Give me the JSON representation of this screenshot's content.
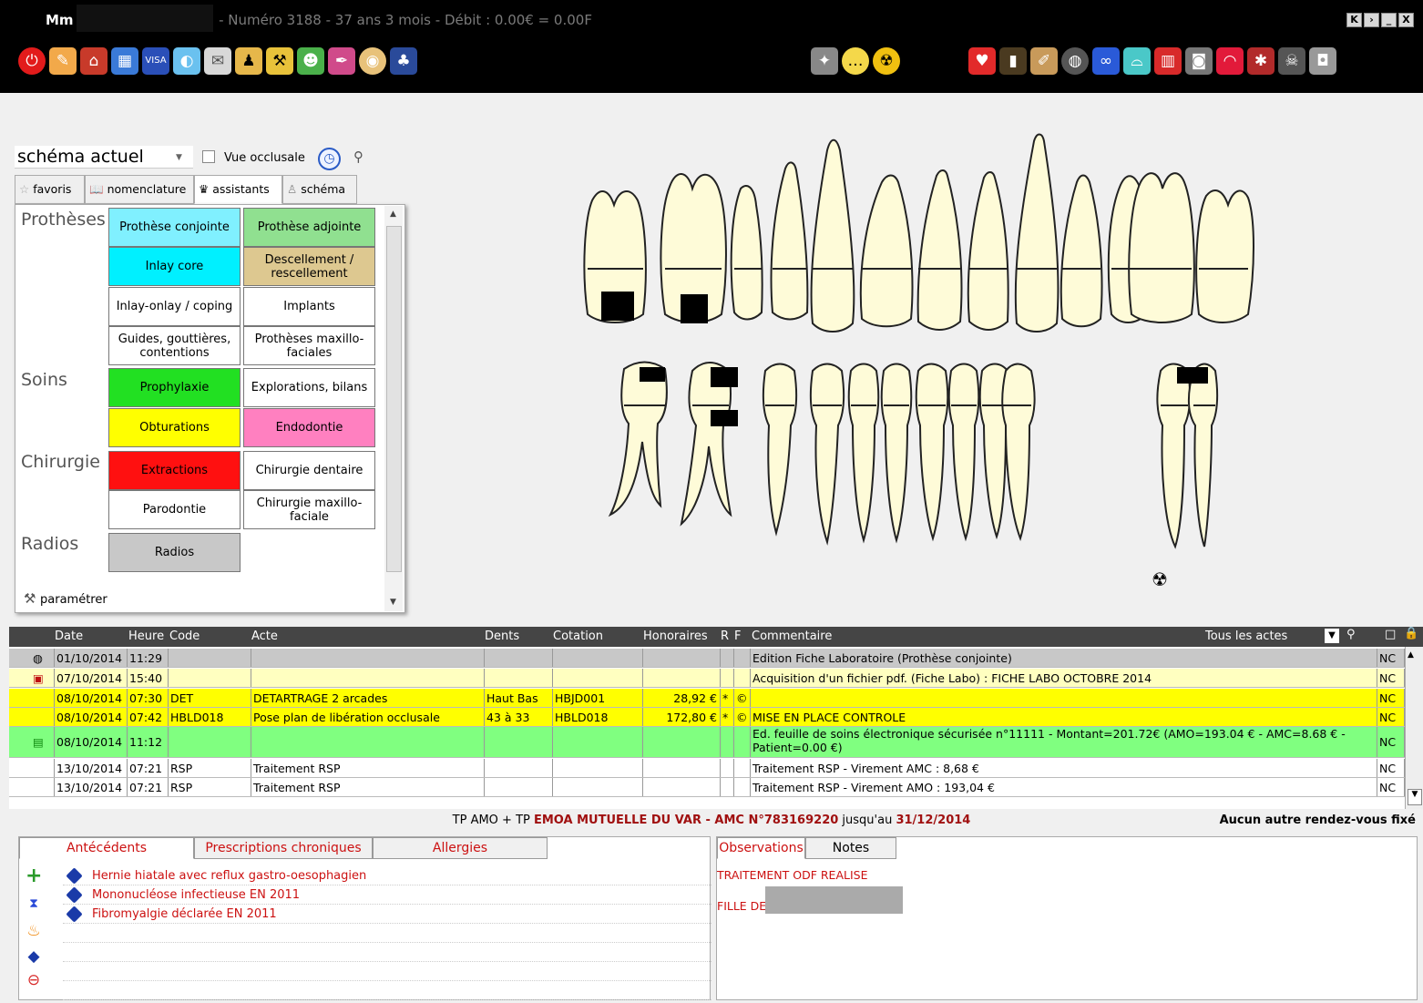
{
  "window": {
    "title_prefix": "Mm",
    "title": "- Numéro 3188  -  37 ans 3 mois  - Débit : 0.00€ = 0.00F",
    "controls": [
      "K",
      "›",
      "_",
      "X"
    ]
  },
  "toolbar": {
    "left_icons": [
      "power-icon",
      "pencil-icon",
      "home-icon",
      "agenda-icon",
      "visa-card-icon",
      "pills-icon",
      "mail-icon",
      "worker-icon",
      "drill-icon",
      "people-icon",
      "pen-icon",
      "disc-icon",
      "family-icon"
    ],
    "mid_icons": [
      "magic-wand-icon",
      "speech-bubble-icon",
      "radiation-icon"
    ],
    "right_icons": [
      "heart-icon",
      "tablet-icon",
      "brush-icon",
      "globe-icon",
      "glasses-icon",
      "tooth-icon",
      "teeth-icon",
      "camera-device-icon",
      "lips-icon",
      "bug-icon",
      "skull-icon",
      "photo-camera-icon"
    ]
  },
  "left_panel": {
    "schema_select": "schéma actuel",
    "vue_label": "Vue occlusale",
    "tabs": [
      "favoris",
      "nomenclature",
      "assistants",
      "schéma"
    ],
    "sections": {
      "protheses": "Prothèses",
      "soins": "Soins",
      "chirurgie": "Chirurgie",
      "radios": "Radios"
    },
    "buttons": {
      "prothese_conjointe": "Prothèse conjointe",
      "prothese_adjointe": "Prothèse adjointe",
      "inlay_core": "Inlay core",
      "descellement": "Descellement / rescellement",
      "inlay_onlay": "Inlay-onlay / coping",
      "implants": "Implants",
      "guides": "Guides, gouttières, contentions",
      "protheses_mf": "Prothèses maxillo-faciales",
      "prophylaxie": "Prophylaxie",
      "explorations": "Explorations, bilans",
      "obturations": "Obturations",
      "endodontie": "Endodontie",
      "extractions": "Extractions",
      "chirurgie_dentaire": "Chirurgie dentaire",
      "parodontie": "Parodontie",
      "chirurgie_mf": "Chirurgie maxillo-faciale",
      "radios": "Radios"
    },
    "parametrer": "paramétrer"
  },
  "acts": {
    "headers": {
      "date": "Date",
      "heure": "Heure",
      "code": "Code",
      "acte": "Acte",
      "dents": "Dents",
      "cotation": "Cotation",
      "honoraires": "Honoraires",
      "r": "R",
      "f": "F",
      "commentaire": "Commentaire",
      "filter": "Tous les actes"
    },
    "rows": [
      {
        "date": "01/10/2014",
        "heure": "11:29",
        "code": "",
        "acte": "",
        "dents": "",
        "cotation": "",
        "honoraires": "",
        "r": "",
        "f": "",
        "commentaire": "Edition Fiche Laboratoire (Prothèse conjointe)",
        "nc": "NC"
      },
      {
        "date": "07/10/2014",
        "heure": "15:40",
        "code": "",
        "acte": "",
        "dents": "",
        "cotation": "",
        "honoraires": "",
        "r": "",
        "f": "",
        "commentaire": "Acquisition d'un fichier pdf. (Fiche Labo)  : FICHE LABO OCTOBRE 2014",
        "nc": "NC"
      },
      {
        "date": "08/10/2014",
        "heure": "07:30",
        "code": "DET",
        "acte": "DETARTRAGE 2 arcades",
        "dents": "Haut Bas",
        "cotation": "HBJD001",
        "honoraires": "28,92 €",
        "r": "*",
        "f": "©",
        "commentaire": "",
        "nc": "NC"
      },
      {
        "date": "08/10/2014",
        "heure": "07:42",
        "code": "HBLD018",
        "acte": "Pose plan de libération occlusale",
        "dents": "43 à 33",
        "cotation": "HBLD018",
        "honoraires": "172,80 €",
        "r": "*",
        "f": "©",
        "commentaire": "MISE EN PLACE CONTROLE",
        "nc": "NC"
      },
      {
        "date": "08/10/2014",
        "heure": "11:12",
        "code": "",
        "acte": "",
        "dents": "",
        "cotation": "",
        "honoraires": "",
        "r": "",
        "f": "",
        "commentaire": "Ed. feuille de soins électronique sécurisée n°11111 - Montant=201.72€ (AMO=193.04 € - AMC=8.68 € - Patient=0.00 €)",
        "nc": "NC"
      },
      {
        "date": "13/10/2014",
        "heure": "07:21",
        "code": "RSP",
        "acte": "Traitement RSP",
        "dents": "",
        "cotation": "",
        "honoraires": "",
        "r": "",
        "f": "",
        "commentaire": "Traitement RSP - Virement AMC : 8,68 €",
        "nc": "NC"
      },
      {
        "date": "13/10/2014",
        "heure": "07:21",
        "code": "RSP",
        "acte": "Traitement RSP",
        "dents": "",
        "cotation": "",
        "honoraires": "",
        "r": "",
        "f": "",
        "commentaire": "Traitement RSP - Virement AMO : 193,04 €",
        "nc": "NC"
      }
    ]
  },
  "tp_line": {
    "prefix": "TP AMO + TP ",
    "mutuelle": "EMOA MUTUELLE DU VAR - AMC N°783169220",
    "middle": " jusqu'au ",
    "date": "31/12/2014"
  },
  "rdv": "Aucun autre rendez-vous fixé",
  "bottom_left": {
    "tabs": [
      "Antécédents",
      "Prescriptions chroniques",
      "Allergies"
    ],
    "antecedents": [
      "Hernie hiatale avec reflux gastro-oesophagien",
      "Mononucléose infectieuse  EN 2011",
      "Fibromyalgie  déclarée EN 2011"
    ]
  },
  "bottom_right": {
    "tabs": [
      "Observations",
      "Notes"
    ],
    "lines": [
      "TRAITEMENT ODF  REALISE",
      "FILLE DE"
    ]
  },
  "colors": {
    "cyan_light": "#80f0ff",
    "cyan": "#00f0ff",
    "green_light": "#90e090",
    "tan": "#ddc890",
    "green": "#22e022",
    "yellow": "#ffff00",
    "pink": "#ff80c0",
    "red": "#ff1010",
    "gray": "#c8c8c8",
    "row_gray": "#c8c8c8",
    "row_yellow": "#ffffc0",
    "row_bright_yellow": "#ffff00",
    "row_green": "#80ff80"
  }
}
